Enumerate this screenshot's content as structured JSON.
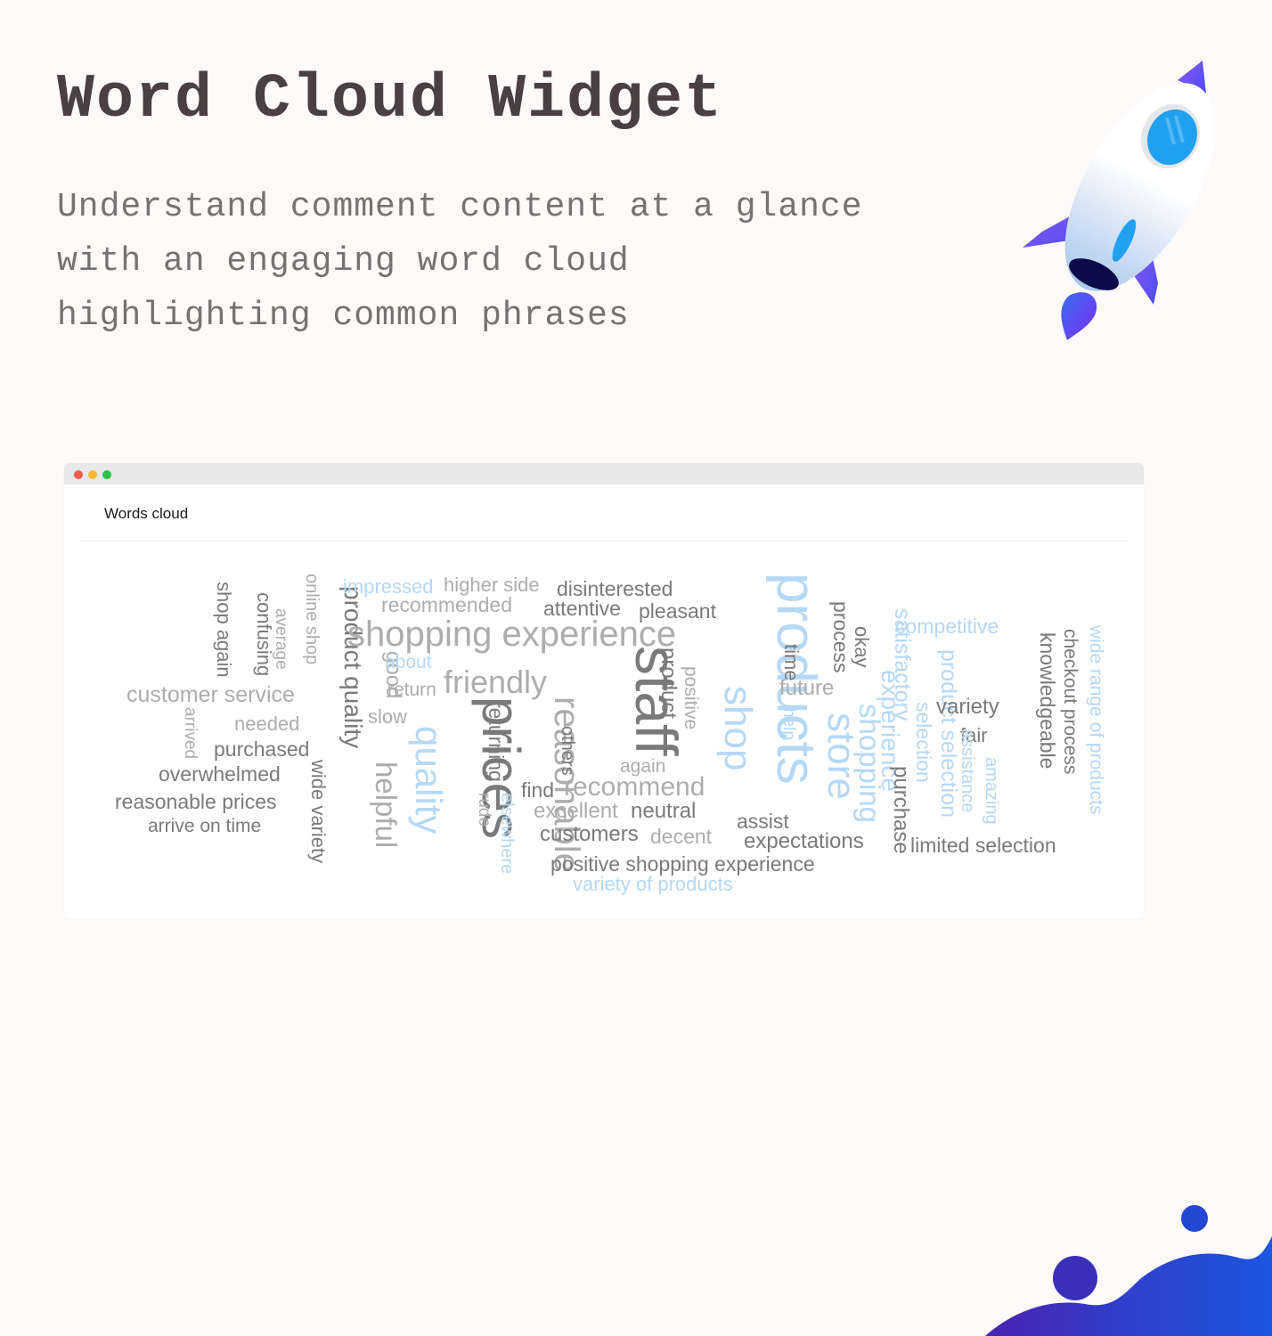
{
  "hero": {
    "title": "Word Cloud Widget",
    "subtitle_lines": [
      "Understand comment content at a glance",
      "with an engaging word cloud",
      "highlighting common phrases"
    ]
  },
  "decorations": {
    "rocket_icon": "rocket-illustration",
    "wave_icon": "wave-blob-decoration"
  },
  "window": {
    "controls": [
      "close",
      "minimize",
      "maximize"
    ],
    "title": "Words cloud"
  },
  "colors": {
    "background": "#fefaf9",
    "title": "#4a4044",
    "subtitle": "#777172",
    "word_dark": "#7a7a7a",
    "word_mid": "#adadad",
    "word_blue": "#b5d8f6",
    "accent_purple": "#6a4cf0",
    "accent_blue": "#1f55e0"
  },
  "words": [
    {
      "text": "shop again",
      "tone": "dark",
      "orientation": "vertical"
    },
    {
      "text": "confusing",
      "tone": "dark",
      "orientation": "vertical"
    },
    {
      "text": "average",
      "tone": "mid",
      "orientation": "vertical"
    },
    {
      "text": "online shop",
      "tone": "mid",
      "orientation": "vertical"
    },
    {
      "text": "product quality",
      "tone": "dark",
      "orientation": "vertical"
    },
    {
      "text": "customer service",
      "tone": "mid",
      "orientation": "horizontal"
    },
    {
      "text": "arrived",
      "tone": "mid",
      "orientation": "vertical"
    },
    {
      "text": "needed",
      "tone": "mid",
      "orientation": "horizontal"
    },
    {
      "text": "purchased",
      "tone": "dark",
      "orientation": "horizontal"
    },
    {
      "text": "overwhelmed",
      "tone": "dark",
      "orientation": "horizontal"
    },
    {
      "text": "wide variety",
      "tone": "dark",
      "orientation": "vertical"
    },
    {
      "text": "reasonable prices",
      "tone": "dark",
      "orientation": "horizontal"
    },
    {
      "text": "arrive on time",
      "tone": "dark",
      "orientation": "horizontal"
    },
    {
      "text": "impressed",
      "tone": "blue",
      "orientation": "horizontal"
    },
    {
      "text": "higher side",
      "tone": "mid",
      "orientation": "horizontal"
    },
    {
      "text": "recommended",
      "tone": "mid",
      "orientation": "horizontal"
    },
    {
      "text": "shopping experience",
      "tone": "mid",
      "orientation": "horizontal"
    },
    {
      "text": "good",
      "tone": "mid",
      "orientation": "vertical"
    },
    {
      "text": "about",
      "tone": "blue",
      "orientation": "horizontal"
    },
    {
      "text": "return",
      "tone": "mid",
      "orientation": "horizontal"
    },
    {
      "text": "friendly",
      "tone": "mid",
      "orientation": "horizontal"
    },
    {
      "text": "slow",
      "tone": "mid",
      "orientation": "horizontal"
    },
    {
      "text": "helpful",
      "tone": "mid",
      "orientation": "vertical"
    },
    {
      "text": "quality",
      "tone": "blue",
      "orientation": "vertical"
    },
    {
      "text": "prices",
      "tone": "dark",
      "orientation": "vertical"
    },
    {
      "text": "returning",
      "tone": "dark",
      "orientation": "vertical"
    },
    {
      "text": "rude",
      "tone": "mid",
      "orientation": "vertical"
    },
    {
      "text": "elsewhere",
      "tone": "blue",
      "orientation": "vertical"
    },
    {
      "text": "reasonable",
      "tone": "mid",
      "orientation": "vertical"
    },
    {
      "text": "disinterested",
      "tone": "dark",
      "orientation": "horizontal"
    },
    {
      "text": "attentive",
      "tone": "dark",
      "orientation": "horizontal"
    },
    {
      "text": "pleasant",
      "tone": "dark",
      "orientation": "horizontal"
    },
    {
      "text": "staff",
      "tone": "dark",
      "orientation": "vertical"
    },
    {
      "text": "others",
      "tone": "dark",
      "orientation": "vertical"
    },
    {
      "text": "product",
      "tone": "dark",
      "orientation": "vertical"
    },
    {
      "text": "positive",
      "tone": "mid",
      "orientation": "vertical"
    },
    {
      "text": "again",
      "tone": "mid",
      "orientation": "horizontal"
    },
    {
      "text": "find",
      "tone": "dark",
      "orientation": "horizontal"
    },
    {
      "text": "recommend",
      "tone": "mid",
      "orientation": "horizontal"
    },
    {
      "text": "excellent",
      "tone": "mid",
      "orientation": "horizontal"
    },
    {
      "text": "neutral",
      "tone": "dark",
      "orientation": "horizontal"
    },
    {
      "text": "customers",
      "tone": "dark",
      "orientation": "horizontal"
    },
    {
      "text": "decent",
      "tone": "mid",
      "orientation": "horizontal"
    },
    {
      "text": "positive shopping experience",
      "tone": "dark",
      "orientation": "horizontal"
    },
    {
      "text": "variety of products",
      "tone": "blue",
      "orientation": "horizontal"
    },
    {
      "text": "shop",
      "tone": "blue",
      "orientation": "vertical"
    },
    {
      "text": "products",
      "tone": "blue",
      "orientation": "vertical"
    },
    {
      "text": "time",
      "tone": "dark",
      "orientation": "vertical"
    },
    {
      "text": "help",
      "tone": "blue",
      "orientation": "vertical"
    },
    {
      "text": "store",
      "tone": "blue",
      "orientation": "vertical"
    },
    {
      "text": "process",
      "tone": "dark",
      "orientation": "vertical"
    },
    {
      "text": "okay",
      "tone": "dark",
      "orientation": "vertical"
    },
    {
      "text": "future",
      "tone": "mid",
      "orientation": "horizontal"
    },
    {
      "text": "shopping",
      "tone": "blue",
      "orientation": "vertical"
    },
    {
      "text": "experience",
      "tone": "blue",
      "orientation": "vertical"
    },
    {
      "text": "satisfactory",
      "tone": "blue",
      "orientation": "vertical"
    },
    {
      "text": "purchase",
      "tone": "dark",
      "orientation": "vertical"
    },
    {
      "text": "assist",
      "tone": "dark",
      "orientation": "horizontal"
    },
    {
      "text": "expectations",
      "tone": "dark",
      "orientation": "horizontal"
    },
    {
      "text": "competitive",
      "tone": "blue",
      "orientation": "horizontal"
    },
    {
      "text": "product selection",
      "tone": "blue",
      "orientation": "vertical"
    },
    {
      "text": "selection",
      "tone": "blue",
      "orientation": "vertical"
    },
    {
      "text": "variety",
      "tone": "dark",
      "orientation": "horizontal"
    },
    {
      "text": "fair",
      "tone": "dark",
      "orientation": "horizontal"
    },
    {
      "text": "assistance",
      "tone": "blue",
      "orientation": "vertical"
    },
    {
      "text": "amazing",
      "tone": "blue",
      "orientation": "vertical"
    },
    {
      "text": "knowledgeable",
      "tone": "dark",
      "orientation": "vertical"
    },
    {
      "text": "checkout process",
      "tone": "dark",
      "orientation": "vertical"
    },
    {
      "text": "wide range of products",
      "tone": "blue",
      "orientation": "vertical"
    },
    {
      "text": "limited selection",
      "tone": "dark",
      "orientation": "horizontal"
    }
  ]
}
